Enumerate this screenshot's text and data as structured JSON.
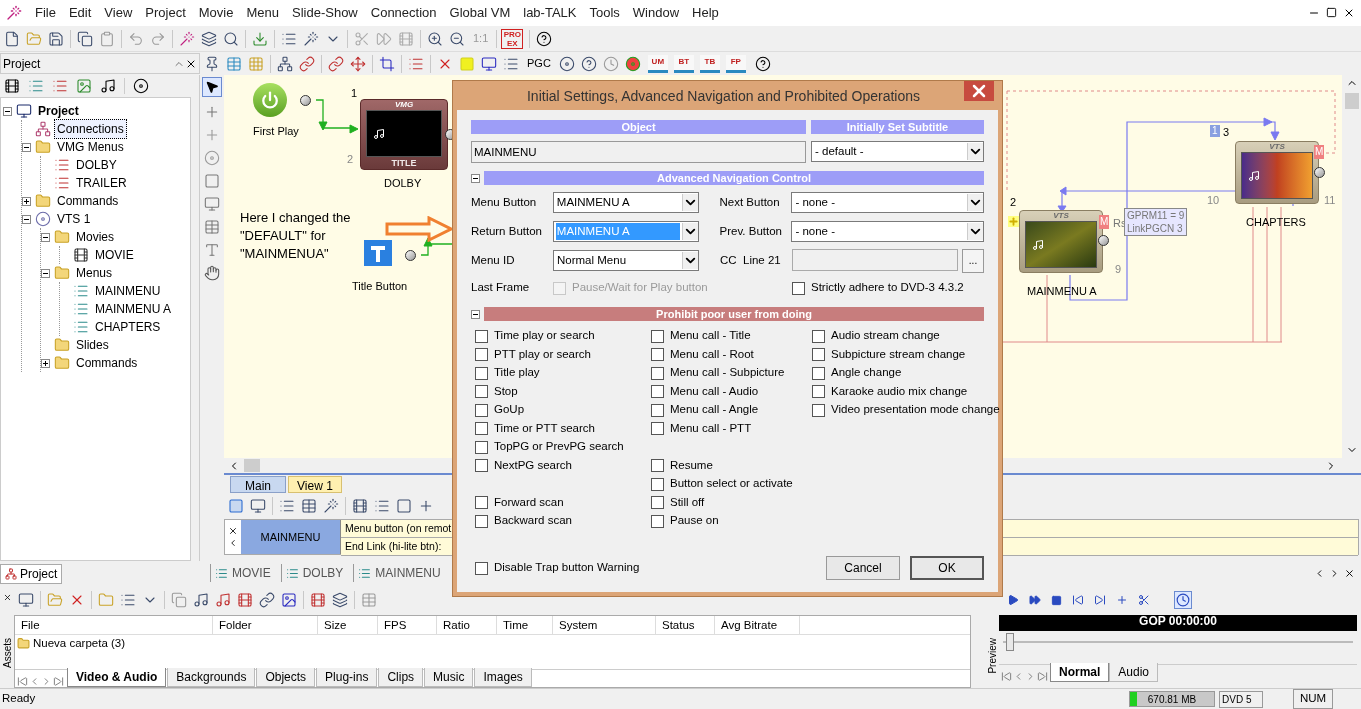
{
  "menu_bar": [
    "File",
    "Edit",
    "View",
    "Project",
    "Movie",
    "Menu",
    "Slide-Show",
    "Connection",
    "Global VM",
    "lab-TALK",
    "Tools",
    "Window",
    "Help"
  ],
  "toolbar": {
    "zoom_ratio": "1:1",
    "pro_ex": "PRO EX"
  },
  "toolbar2": {
    "pgc": "PGC",
    "tags": [
      "UM",
      "BT",
      "TB",
      "FP"
    ]
  },
  "project_panel": {
    "title": "Project",
    "tree": [
      {
        "label": "Project",
        "kind": "project",
        "expanded": true,
        "selected": false,
        "children": [
          {
            "label": "Connections",
            "kind": "connections",
            "selected": true
          },
          {
            "label": "VMG Menus",
            "kind": "folder",
            "expanded": true,
            "selected": false,
            "children": [
              {
                "label": "DOLBY",
                "kind": "vmg-menu",
                "selected": false
              },
              {
                "label": "TRAILER",
                "kind": "vmg-menu",
                "selected": false
              }
            ]
          },
          {
            "label": "Commands",
            "kind": "folder",
            "expanded": false,
            "selected": false
          },
          {
            "label": "VTS 1",
            "kind": "disc",
            "expanded": true,
            "selected": false,
            "children": [
              {
                "label": "Movies",
                "kind": "folder",
                "expanded": true,
                "selected": false,
                "children": [
                  {
                    "label": "MOVIE",
                    "kind": "movie",
                    "selected": false
                  }
                ]
              },
              {
                "label": "Menus",
                "kind": "folder",
                "expanded": true,
                "selected": false,
                "children": [
                  {
                    "label": "MAINMENU",
                    "kind": "vts-menu",
                    "selected": false
                  },
                  {
                    "label": "MAINMENU A",
                    "kind": "vts-menu",
                    "selected": false
                  },
                  {
                    "label": "CHAPTERS",
                    "kind": "vts-menu",
                    "selected": false
                  }
                ]
              },
              {
                "label": "Slides",
                "kind": "folder",
                "selected": false
              },
              {
                "label": "Commands",
                "kind": "folder",
                "expanded": false,
                "selected": false
              }
            ]
          }
        ]
      }
    ]
  },
  "canvas": {
    "first_play": {
      "label": "First Play"
    },
    "dolby": {
      "label": "DOLBY",
      "header": "VMG",
      "footer": "TITLE",
      "numbers": [
        "1",
        "2"
      ]
    },
    "note": "Here I changed the\n\"DEFAULT\" for\n\"MAINMENUA\"",
    "title_button": {
      "label": "Title Button"
    },
    "mainmenu_a": {
      "label": "MAINMENU A",
      "header": "VTS",
      "badge": "M",
      "resume": "Rs",
      "numbers": [
        "2",
        "9"
      ]
    },
    "command": [
      "GPRM11 = 9",
      "LinkPGCN 3"
    ],
    "chapters": {
      "label": "CHAPTERS",
      "header": "VTS",
      "badge": "M",
      "numbers": [
        "1",
        "3",
        "10",
        "11"
      ]
    }
  },
  "view_tabs": [
    {
      "label": "Main",
      "selected": true
    },
    {
      "label": "View 1",
      "selected": false
    }
  ],
  "link_table": {
    "object": "MAINMENU",
    "rows": [
      "Menu button (on remot",
      "End Link (hi-lite btn):"
    ]
  },
  "panel_tab": "Project",
  "document_tabs": [
    "MOVIE",
    "DOLBY",
    "MAINMENU"
  ],
  "dialog": {
    "title": "Initial Settings, Advanced Navigation and Prohibited Operations",
    "object": {
      "header": "Object",
      "value": "MAINMENU"
    },
    "subtitle": {
      "header": "Initially Set Subtitle",
      "value": "- default -"
    },
    "advanced": {
      "title": "Advanced Navigation Control",
      "expanded": true,
      "fields": [
        {
          "label": "Menu Button",
          "kind": "dropdown",
          "value": "MAINMENU A",
          "selected": false
        },
        {
          "label": "Next Button",
          "kind": "dropdown",
          "value": "- none -",
          "selected": false
        },
        {
          "label": "Return Button",
          "kind": "dropdown",
          "value": "MAINMENU A",
          "selected": true
        },
        {
          "label": "Prev. Button",
          "kind": "dropdown",
          "value": "- none -",
          "selected": false
        },
        {
          "label": "Menu ID",
          "kind": "dropdown",
          "value": "Normal Menu",
          "selected": false
        },
        {
          "label": "CC  Line 21",
          "kind": "text",
          "browse": "..."
        }
      ],
      "last_frame": {
        "label": "Last Frame",
        "option": {
          "label": "Pause/Wait for Play button",
          "checked": false,
          "disabled": true
        }
      },
      "strict": {
        "label": "Strictly adhere to DVD-3 4.3.2",
        "checked": false,
        "disabled": false
      }
    },
    "prohibit": {
      "title": "Prohibit poor user from doing",
      "expanded": true,
      "rows": [
        [
          {
            "label": "Time play or search",
            "checked": false
          },
          {
            "label": "Menu call - Title",
            "checked": false
          },
          {
            "label": "Audio stream change",
            "checked": false
          }
        ],
        [
          {
            "label": "PTT play or search",
            "checked": false
          },
          {
            "label": "Menu call - Root",
            "checked": false
          },
          {
            "label": "Subpicture stream change",
            "checked": false
          }
        ],
        [
          {
            "label": "Title play",
            "checked": false
          },
          {
            "label": "Menu call - Subpicture",
            "checked": false
          },
          {
            "label": "Angle change",
            "checked": false
          }
        ],
        [
          {
            "label": "Stop",
            "checked": false
          },
          {
            "label": "Menu call - Audio",
            "checked": false
          },
          {
            "label": "Karaoke audio mix change",
            "checked": false
          }
        ],
        [
          {
            "label": "GoUp",
            "checked": false
          },
          {
            "label": "Menu call - Angle",
            "checked": false
          },
          {
            "label": "Video presentation mode change",
            "checked": false
          }
        ],
        [
          {
            "label": "Time or PTT search",
            "checked": false
          },
          {
            "label": "Menu call - PTT",
            "checked": false
          },
          null
        ],
        [
          {
            "label": "TopPG or PrevPG search",
            "checked": false
          },
          null,
          null
        ],
        [
          {
            "label": "NextPG search",
            "checked": false
          },
          {
            "label": "Resume",
            "checked": false
          },
          null
        ],
        [
          null,
          {
            "label": "Button select or activate",
            "checked": false
          },
          null
        ],
        [
          {
            "label": "Forward scan",
            "checked": false
          },
          {
            "label": "Still off",
            "checked": false
          },
          null
        ],
        [
          {
            "label": "Backward scan",
            "checked": false
          },
          {
            "label": "Pause on",
            "checked": false
          },
          null
        ]
      ]
    },
    "trap_warning": {
      "label": "Disable Trap button Warning",
      "checked": false
    },
    "buttons": [
      "Cancel",
      "OK"
    ]
  },
  "assets": {
    "side_label": "Assets",
    "columns": [
      "File",
      "Folder",
      "Size",
      "FPS",
      "Ratio",
      "Time",
      "System",
      "Status",
      "Avg Bitrate"
    ],
    "rows": [
      {
        "cells": [
          "Nueva carpeta (3)"
        ]
      }
    ],
    "tabs": [
      {
        "label": "Video & Audio",
        "selected": true
      },
      {
        "label": "Backgrounds",
        "selected": false
      },
      {
        "label": "Objects",
        "selected": false
      },
      {
        "label": "Plug-ins",
        "selected": false
      },
      {
        "label": "Clips",
        "selected": false
      },
      {
        "label": "Music",
        "selected": false
      },
      {
        "label": "Images",
        "selected": false
      }
    ]
  },
  "preview": {
    "side_label": "Preview",
    "timecode": "GOP 00:00:00",
    "level": 0.02,
    "tabs": [
      {
        "label": "Normal",
        "selected": true
      },
      {
        "label": "Audio",
        "selected": false
      }
    ]
  },
  "status_bar": {
    "text": "Ready",
    "memory": {
      "reading": "670.81 MB",
      "level": 0.08
    },
    "disc": "DVD 5",
    "num": "NUM"
  }
}
